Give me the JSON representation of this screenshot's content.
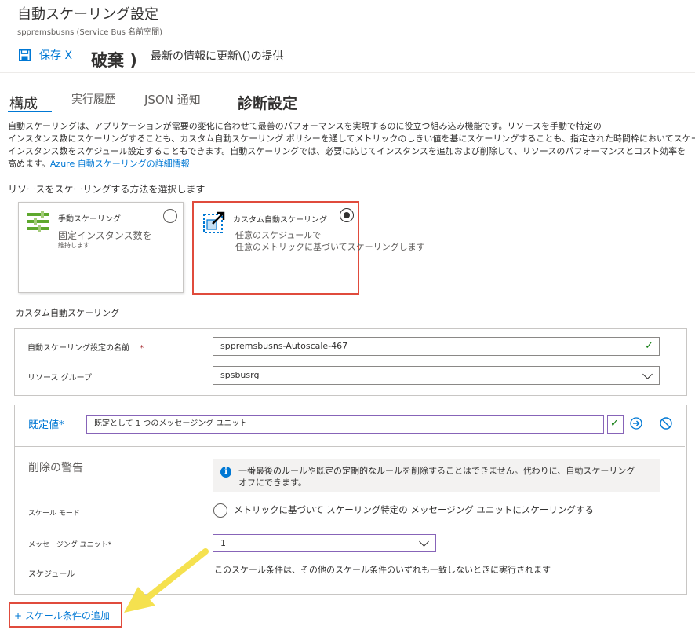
{
  "header": {
    "title": "自動スケーリング設定",
    "subtitle": "sppremsbusns (Service Bus 名前空間)"
  },
  "toolbar": {
    "save_label": "保存 X",
    "discard_label": "破棄 )",
    "refresh_label": "最新の情報に更新\\()の提供"
  },
  "tabs": [
    {
      "label": "構成"
    },
    {
      "label": "実行履歴"
    },
    {
      "label": "JSON 通知"
    },
    {
      "label": "診断設定"
    }
  ],
  "description": {
    "lines": [
      "自動スケーリングは、アプリケーションが需要の変化に合わせて最善のパフォーマンスを実現するのに役立つ組み込み機能です。リソースを手動で特定の",
      "インスタンス数にスケーリングすることも、カスタム自動スケーリング ポリシーを通してメトリックのしきい値を基にスケーリングすることも、指定された時間枠においてスケーリング",
      "インスタンス数をスケジュール設定することもできます。自動スケーリングでは、必要に応じてインスタンスを追加および削除して、リソースのパフォーマンスとコスト効率を"
    ],
    "last_line": "高めます。",
    "link": "Azure 自動スケーリングの詳細情報"
  },
  "choose_label": "リソースをスケーリングする方法を選択します",
  "options": {
    "manual": {
      "title": "手動スケーリング",
      "line1": "固定インスタンス数を",
      "line2": "維持します"
    },
    "custom": {
      "title": "カスタム自動スケーリング",
      "line1": "任意のスケジュールで",
      "line2": "任意のメトリックに基づいてスケーリングします"
    }
  },
  "custom_section_label": "カスタム自動スケーリング",
  "form": {
    "name_label": "自動スケーリング設定の名前",
    "required_mark": "*",
    "name_value": "sppremsbusns-Autoscale-467",
    "rg_label": "リソース グループ",
    "rg_value": "spsbusrg"
  },
  "condition": {
    "default_label": "既定値*",
    "default_value": "既定として 1 つのメッセージング ユニット",
    "delete_warning_label": "削除の警告",
    "warning_line1": "一番最後のルールや既定の定期的なルールを削除することはできません。代わりに、自動スケーリング",
    "warning_line2": "オフにできます。",
    "scale_mode_label": "スケール モード",
    "scale_mode_option": "メトリックに基づいて スケーリング特定の メッセージング ユニットにスケーリングする",
    "units_label": "メッセージング ユニット*",
    "units_value": "1",
    "schedule_label": "スケジュール",
    "schedule_text": "このスケール条件は、その他のスケール条件のいずれも一致しないときに実行されます"
  },
  "add_condition_label": "+ スケール条件の追加",
  "colors": {
    "accent": "#0078d4",
    "highlight": "#e04b3c",
    "arrow": "#f5e14f",
    "purple_border": "#8764b8",
    "success": "#107c10"
  }
}
